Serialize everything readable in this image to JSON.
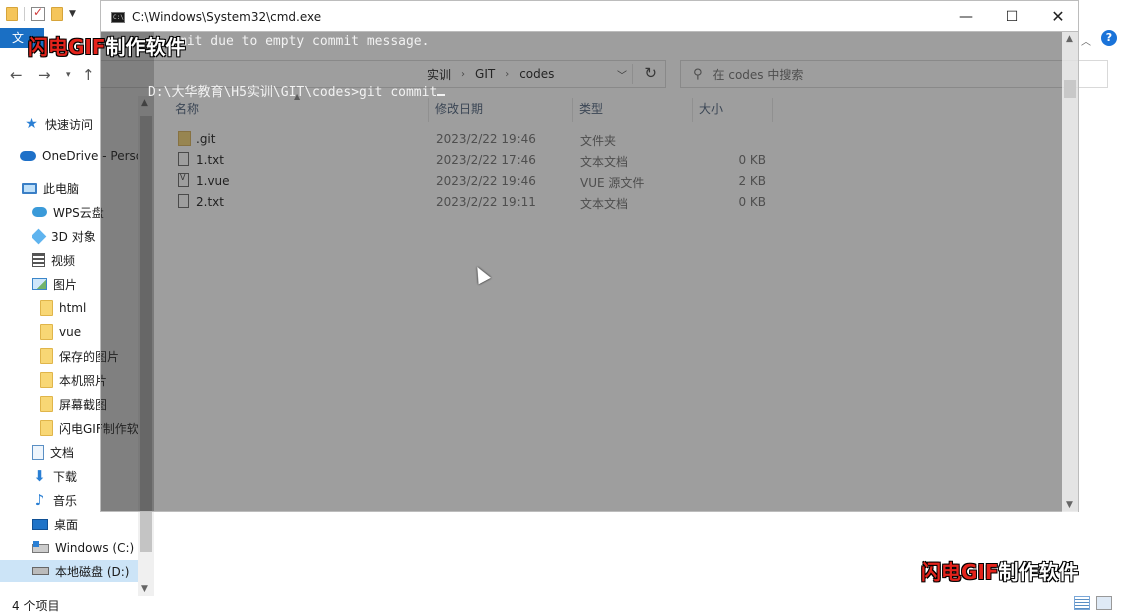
{
  "explorer": {
    "file_tab": "文",
    "address": {
      "crumbs": [
        "实训",
        "GIT",
        "codes"
      ]
    },
    "search": {
      "placeholder": "在 codes 中搜索"
    },
    "nav": {
      "items": [
        {
          "label": "快速访问",
          "icon": "star-icon"
        },
        {
          "label": "OneDrive - Perso",
          "icon": "cloud-icon"
        },
        {
          "label": "此电脑",
          "icon": "pc-icon"
        },
        {
          "label": "WPS云盘",
          "icon": "wps-cloud-icon"
        },
        {
          "label": "3D 对象",
          "icon": "3d-icon"
        },
        {
          "label": "视频",
          "icon": "video-icon"
        },
        {
          "label": "图片",
          "icon": "picture-icon"
        },
        {
          "label": "html",
          "icon": "folder-icon"
        },
        {
          "label": "vue",
          "icon": "folder-icon"
        },
        {
          "label": "保存的图片",
          "icon": "folder-icon"
        },
        {
          "label": "本机照片",
          "icon": "folder-icon"
        },
        {
          "label": "屏幕截图",
          "icon": "folder-icon"
        },
        {
          "label": "闪电GIF制作软",
          "icon": "folder-icon"
        },
        {
          "label": "文档",
          "icon": "document-icon"
        },
        {
          "label": "下载",
          "icon": "download-icon"
        },
        {
          "label": "音乐",
          "icon": "music-icon"
        },
        {
          "label": "桌面",
          "icon": "desktop-icon"
        },
        {
          "label": "Windows (C:)",
          "icon": "drive-c-icon"
        },
        {
          "label": "本地磁盘 (D:)",
          "icon": "drive-d-icon"
        }
      ]
    },
    "columns": {
      "name": "名称",
      "date": "修改日期",
      "type": "类型",
      "size": "大小"
    },
    "files": [
      {
        "name": ".git",
        "date": "2023/2/22 19:46",
        "type": "文件夹",
        "size": "",
        "icon": "folder-icon"
      },
      {
        "name": "1.txt",
        "date": "2023/2/22 17:46",
        "type": "文本文档",
        "size": "0 KB",
        "icon": "text-file-icon"
      },
      {
        "name": "1.vue",
        "date": "2023/2/22 19:46",
        "type": "VUE 源文件",
        "size": "2 KB",
        "icon": "vue-file-icon"
      },
      {
        "name": "2.txt",
        "date": "2023/2/22 19:11",
        "type": "文本文档",
        "size": "0 KB",
        "icon": "text-file-icon"
      }
    ],
    "status": {
      "count": "4 个项目"
    }
  },
  "cmd": {
    "title": "C:\\Windows\\System32\\cmd.exe",
    "icon_text": "C:\\",
    "lines": [
      "mit due to empty commit message.",
      "D:\\大华教育\\H5实训\\GIT\\codes>git commit"
    ]
  },
  "watermark": {
    "highlight": "闪电GIF",
    "rest": "制作软件"
  }
}
